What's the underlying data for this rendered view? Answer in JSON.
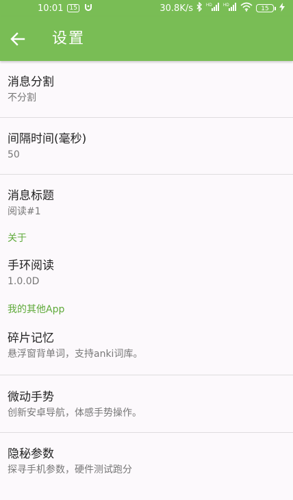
{
  "status_bar": {
    "time": "10:01",
    "notif_badge": "15",
    "speed": "30.8K/s",
    "signal1_label": "HD",
    "signal2_label": "HD",
    "battery": "15",
    "icons": [
      "wechat-icon",
      "bluetooth-icon",
      "signal-icon",
      "signal-icon",
      "wifi-icon",
      "battery-icon",
      "charging-icon"
    ]
  },
  "app_bar": {
    "title": "设置",
    "back_icon": "arrow-left-icon"
  },
  "colors": {
    "accent": "#79bd55",
    "category_text": "#5faa3a",
    "background": "#fcf9fc",
    "divider": "#dedcde"
  },
  "prefs": [
    {
      "title": "消息分割",
      "summary": "不分割"
    },
    {
      "title": "间隔时间(毫秒)",
      "summary": "50"
    },
    {
      "title": "消息标题",
      "summary": "阅读#1"
    }
  ],
  "about": {
    "header": "关于",
    "item": {
      "title": "手环阅读",
      "summary": "1.0.0D"
    }
  },
  "other_apps": {
    "header": "我的其他App",
    "items": [
      {
        "title": "碎片记忆",
        "summary": "悬浮窗背单词，支持anki词库。"
      },
      {
        "title": "微动手势",
        "summary": "创新安卓导航，体感手势操作。"
      },
      {
        "title": "隐秘参数",
        "summary": "探寻手机参数，硬件测试跑分"
      }
    ]
  }
}
